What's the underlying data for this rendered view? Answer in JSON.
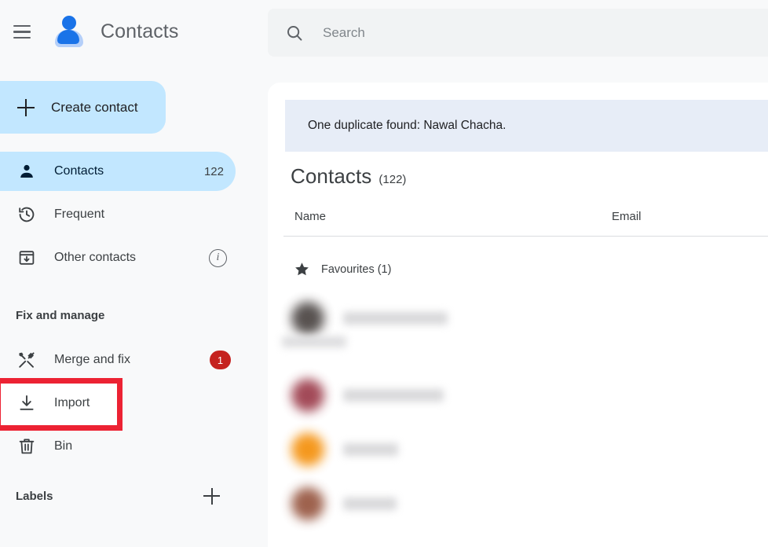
{
  "app": {
    "title": "Contacts",
    "logo_icon": "contacts-person-icon",
    "menu_icon": "hamburger-menu-icon"
  },
  "sidebar": {
    "create_button": {
      "label": "Create contact",
      "icon": "plus-icon",
      "background": "#c2e7ff"
    },
    "items": [
      {
        "id": "contacts",
        "label": "Contacts",
        "icon": "person-icon",
        "count": "122",
        "active": true
      },
      {
        "id": "frequent",
        "label": "Frequent",
        "icon": "history-clock-icon",
        "active": false
      },
      {
        "id": "other-contacts",
        "label": "Other contacts",
        "icon": "archive-down-arrow-icon",
        "info_icon": "info-icon",
        "info_glyph": "i",
        "active": false
      }
    ],
    "section_fix_and_manage": {
      "label": "Fix and manage",
      "items": [
        {
          "id": "merge-and-fix",
          "label": "Merge and fix",
          "icon": "hammer-wrench-icon",
          "badge": "1",
          "badge_color": "#c5221f"
        },
        {
          "id": "import",
          "label": "Import",
          "icon": "download-import-icon",
          "highlighted": true,
          "highlight_color": "#ec2233"
        },
        {
          "id": "bin",
          "label": "Bin",
          "icon": "trash-bin-icon"
        }
      ]
    },
    "labels_section": {
      "title": "Labels",
      "add_icon": "plus-icon"
    }
  },
  "search": {
    "placeholder": "Search",
    "value": "",
    "icon": "search-icon"
  },
  "main": {
    "duplicate_banner": {
      "text": "One duplicate found: Nawal Chacha.",
      "background": "#e7edf7"
    },
    "page_title": "Contacts",
    "page_count": "(122)",
    "columns": {
      "name": "Name",
      "email": "Email"
    },
    "favourites": {
      "label": "Favourites (1)",
      "icon": "star-filled-icon"
    },
    "contacts": [
      {
        "avatar_color": "#4a4442",
        "name_width": 133,
        "redacted": true,
        "has_subline": true
      },
      {
        "avatar_color": "#9b3b4a",
        "name_width": 128,
        "redacted": true,
        "has_subline": false
      },
      {
        "avatar_color": "#f4900c",
        "name_width": 70,
        "redacted": true,
        "has_subline": false
      },
      {
        "avatar_color": "#96553f",
        "name_width": 68,
        "redacted": true,
        "has_subline": false
      }
    ]
  }
}
